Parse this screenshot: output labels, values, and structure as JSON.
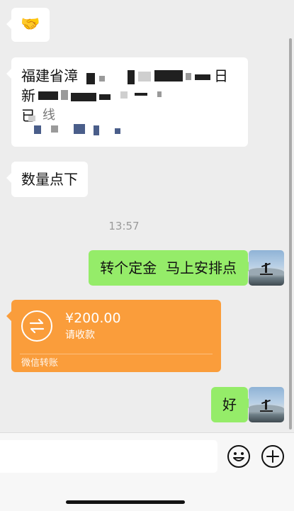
{
  "messages": {
    "emoji": {
      "symbol": "🤝",
      "name": "handshake-emoji"
    },
    "address": {
      "text": "福建省漳 ████████ 日新██████████ 楼█████████ 已█ 线"
    },
    "reply_in": "数量点下",
    "timestamp": "13:57",
    "out_1": "转个定金  马上安排点",
    "transfer": {
      "amount": "¥200.00",
      "status": "请收款",
      "footer": "微信转账"
    },
    "out_2": "好"
  },
  "colors": {
    "background": "#ededed",
    "bubble_in": "#ffffff",
    "bubble_out": "#95ec69",
    "transfer": "#fa9d3b"
  },
  "input_bar": {
    "placeholder": "",
    "emoji_icon": "smiley-face-icon",
    "plus_icon": "plus-circle-icon"
  }
}
